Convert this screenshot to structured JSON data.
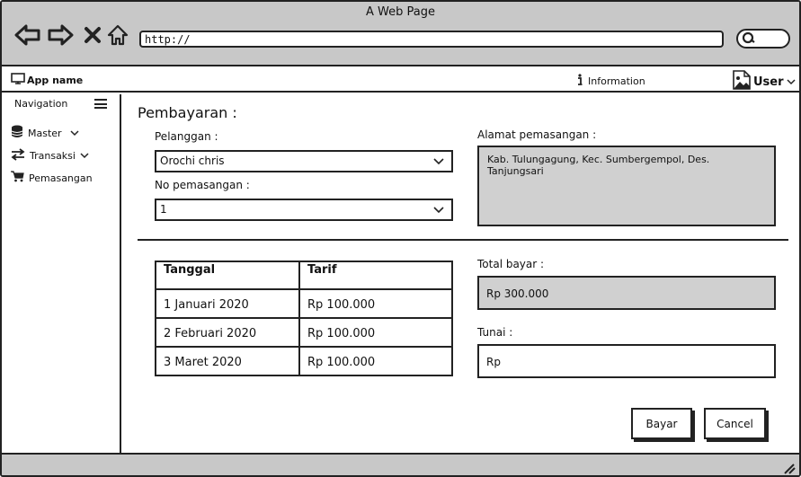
{
  "browser": {
    "window_title": "A Web Page",
    "url": "http://",
    "icons": [
      "back-arrow-icon",
      "forward-arrow-icon",
      "close-x-icon",
      "home-icon",
      "search-icon"
    ]
  },
  "app": {
    "name": "App name",
    "info_label": "Information",
    "user_label": "User"
  },
  "sidebar": {
    "title": "Navigation",
    "items": [
      {
        "label": "Master",
        "icon": "database-icon",
        "has_chevron": true
      },
      {
        "label": "Transaksi",
        "icon": "swap-arrows-icon",
        "has_chevron": true
      },
      {
        "label": "Pemasangan",
        "icon": "cart-icon",
        "has_chevron": false
      }
    ]
  },
  "form": {
    "heading": "Pembayaran :",
    "pelanggan_label": "Pelanggan :",
    "pelanggan_value": "Orochi chris",
    "no_pemasangan_label": "No pemasangan :",
    "no_pemasangan_value": "1",
    "alamat_label": "Alamat pemasangan :",
    "alamat_value": "Kab. Tulungagung, Kec. Sumbergempol, Des. Tanjungsari",
    "total_label": "Total bayar :",
    "total_value": "Rp 300.000",
    "tunai_label": "Tunai :",
    "tunai_value": "Rp"
  },
  "table": {
    "headers": [
      "Tanggal",
      "Tarif"
    ],
    "rows": [
      [
        "1 Januari 2020",
        "Rp 100.000"
      ],
      [
        "2 Februari 2020",
        "Rp 100.000"
      ],
      [
        "3 Maret 2020",
        "Rp 100.000"
      ]
    ]
  },
  "buttons": {
    "pay": "Bayar",
    "cancel": "Cancel"
  },
  "colors": {
    "chrome": "#c8c8c8",
    "readonly_field": "#d0d0d0",
    "stroke": "#222222"
  }
}
